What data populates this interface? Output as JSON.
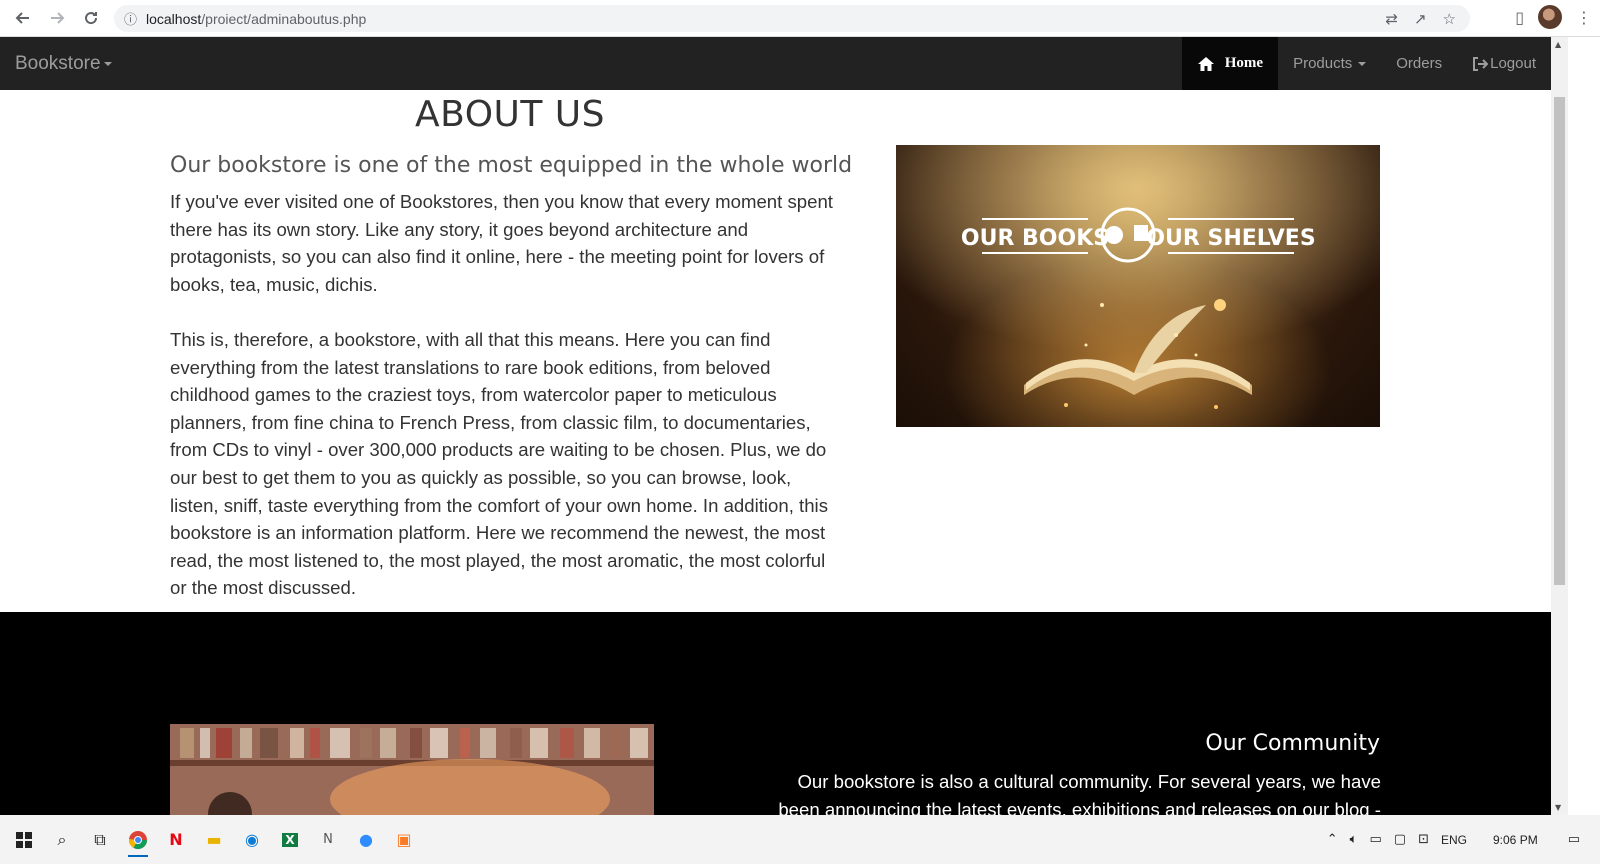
{
  "browser": {
    "url_host": "localhost",
    "url_path": "/proiect/adminaboutus.php",
    "back_icon": "arrow-left-icon",
    "forward_icon": "arrow-right-icon",
    "reload_icon": "reload-icon"
  },
  "navbar": {
    "brand": "Bookstore",
    "items": [
      {
        "label": "Home",
        "icon": "home-icon",
        "active": true
      },
      {
        "label": "Products",
        "dropdown": true
      },
      {
        "label": "Orders"
      },
      {
        "label": "Logout",
        "icon": "logout-icon"
      }
    ]
  },
  "about": {
    "title": "ABOUT US",
    "subtitle": "Our bookstore is one of the most equipped in the whole world",
    "paragraph1": "If you've ever visited one of Bookstores, then you know that every moment spent there has its own story. Like any story, it goes beyond architecture and protagonists, so you can also find it online, here - the meeting point for lovers of books, tea, music, dichis.",
    "paragraph2": "This is, therefore, a bookstore, with all that this means. Here you can find everything from the latest translations to rare book editions, from beloved childhood games to the craziest toys, from watercolor paper to meticulous planners, from fine china to French Press, from classic film, to documentaries, from CDs to vinyl - over 300,000 products are waiting to be chosen. Plus, we do our best to get them to you as quickly as possible, so you can browse, look, listen, sniff, taste everything from the comfort of your own home. In addition, this bookstore is an information platform. Here we recommend the newest, the most read, the most listened to, the most played, the most aromatic, the most colorful or the most discussed.",
    "image_banner_left": "OUR BOOKS",
    "image_banner_right": "OUR SHELVES"
  },
  "community": {
    "title": "Our Community",
    "text": "Our bookstore is also a cultural community. For several years, we have been announcing the latest events, exhibitions and releases on our blog - here you"
  },
  "taskbar": {
    "language": "ENG",
    "time": "9:06 PM"
  },
  "colors": {
    "navbar_bg": "#222222",
    "navbar_active_bg": "#080808",
    "dark_section_bg": "#000000"
  }
}
